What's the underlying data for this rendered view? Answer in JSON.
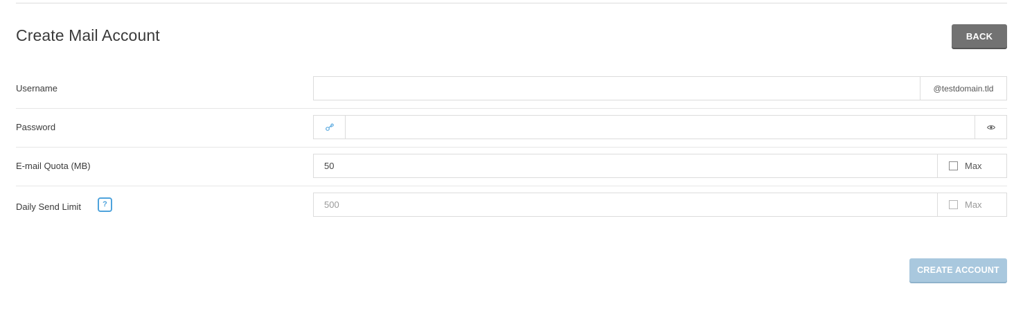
{
  "header": {
    "title": "Create Mail Account",
    "back_label": "BACK"
  },
  "form": {
    "username": {
      "label": "Username",
      "value": "",
      "domain_suffix": "@testdomain.tld"
    },
    "password": {
      "label": "Password",
      "value": "",
      "generate_icon": "key-generate-icon",
      "toggle_icon": "eye-icon"
    },
    "quota": {
      "label": "E-mail Quota (MB)",
      "value": "50",
      "max_label": "Max",
      "max_checked": false
    },
    "send_limit": {
      "label": "Daily Send Limit",
      "help_symbol": "?",
      "value": "500",
      "max_label": "Max",
      "max_checked": false,
      "disabled": true
    }
  },
  "footer": {
    "create_label": "CREATE ACCOUNT",
    "create_disabled": true
  },
  "colors": {
    "back_button": "#727272",
    "create_button_disabled": "#a9c8de",
    "help_icon": "#4ea3dc",
    "border": "#dcdcdc"
  }
}
